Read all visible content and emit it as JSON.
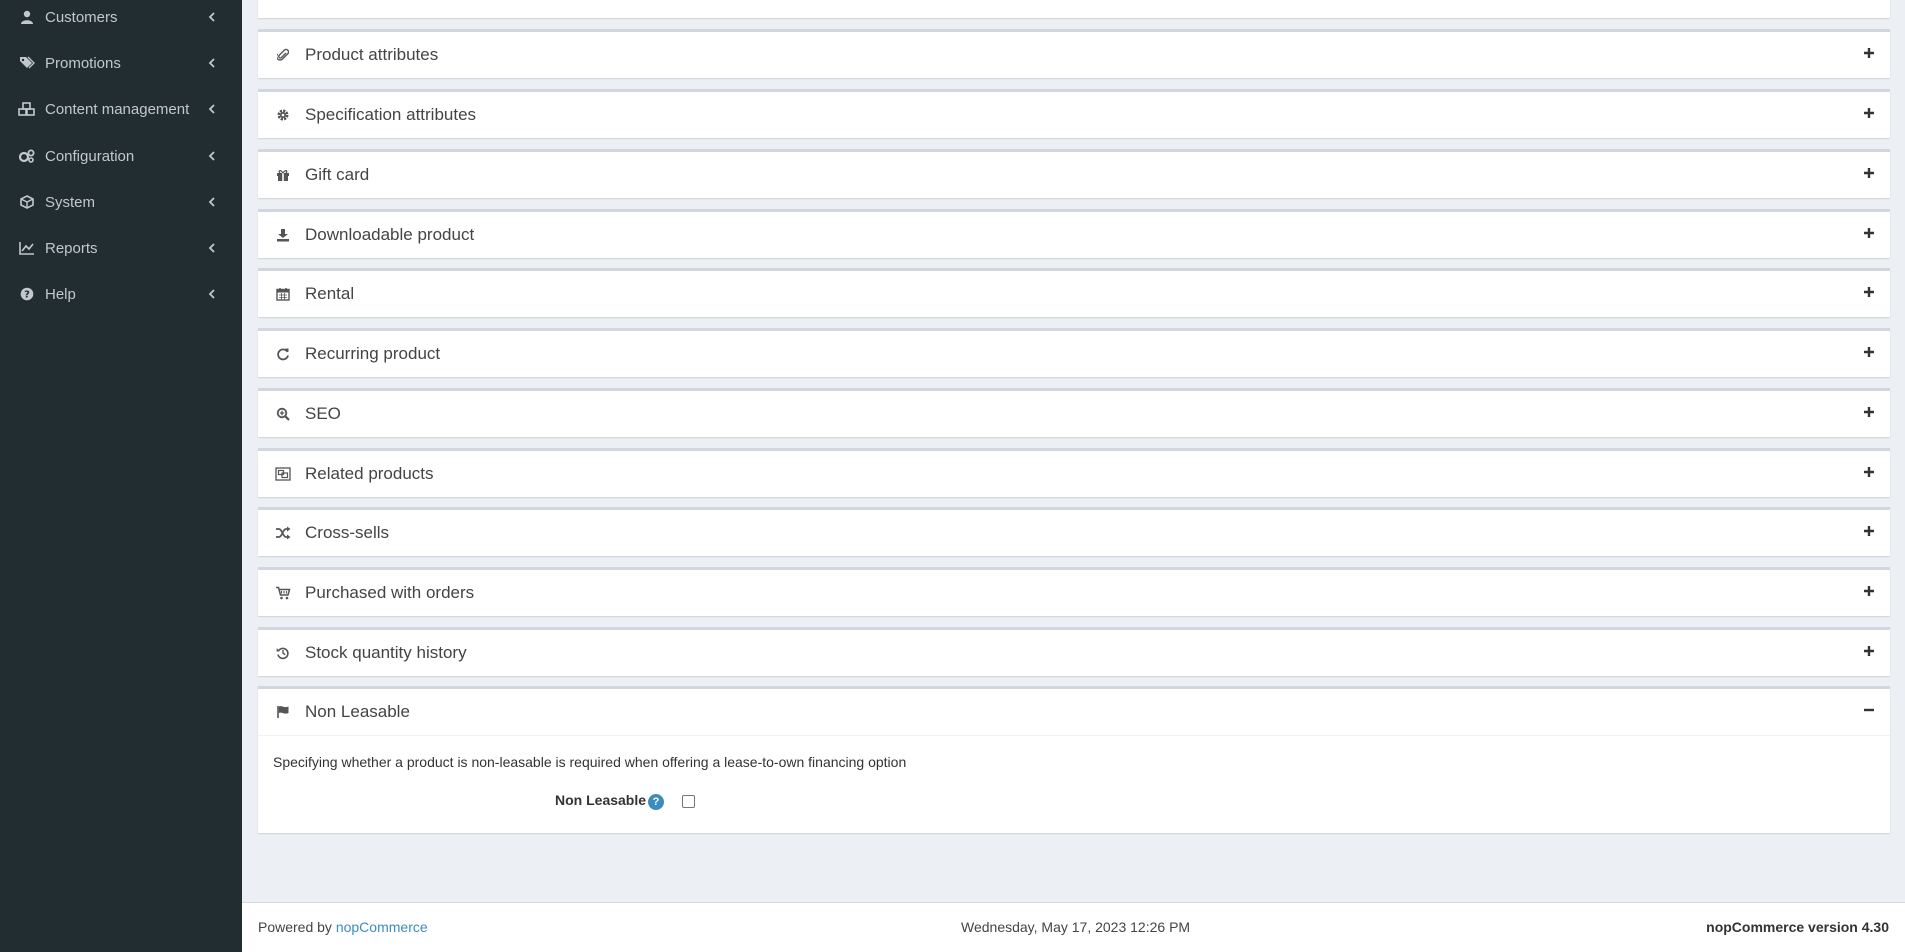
{
  "sidebar": {
    "items": [
      {
        "label": "Customers",
        "icon": "user-icon"
      },
      {
        "label": "Promotions",
        "icon": "tags-icon"
      },
      {
        "label": "Content management",
        "icon": "cubes-icon"
      },
      {
        "label": "Configuration",
        "icon": "gears-icon"
      },
      {
        "label": "System",
        "icon": "cube-icon"
      },
      {
        "label": "Reports",
        "icon": "line-chart-icon"
      },
      {
        "label": "Help",
        "icon": "question-circle-icon"
      }
    ]
  },
  "panels": [
    {
      "title": "Product attributes",
      "icon": "paperclip-icon"
    },
    {
      "title": "Specification attributes",
      "icon": "cog-icon"
    },
    {
      "title": "Gift card",
      "icon": "gift-icon"
    },
    {
      "title": "Downloadable product",
      "icon": "download-icon"
    },
    {
      "title": "Rental",
      "icon": "calendar-icon"
    },
    {
      "title": "Recurring product",
      "icon": "repeat-icon"
    },
    {
      "title": "SEO",
      "icon": "search-plus-icon"
    },
    {
      "title": "Related products",
      "icon": "object-group-icon"
    },
    {
      "title": "Cross-sells",
      "icon": "random-icon"
    },
    {
      "title": "Purchased with orders",
      "icon": "cart-icon"
    },
    {
      "title": "Stock quantity history",
      "icon": "history-icon"
    }
  ],
  "non_leasable_panel": {
    "title": "Non Leasable",
    "icon": "flag-icon",
    "description": "Specifying whether a product is non-leasable is required when offering a lease-to-own financing option",
    "field_label": "Non Leasable",
    "help_glyph": "?",
    "checked": false
  },
  "footer": {
    "powered_by": "Powered by",
    "link_text": "nopCommerce",
    "datetime": "Wednesday, May 17, 2023 12:26 PM",
    "version": "nopCommerce version 4.30"
  },
  "colors": {
    "sidebar_bg": "#222d32",
    "content_bg": "#ecf0f5",
    "accent": "#3c8dbc"
  }
}
